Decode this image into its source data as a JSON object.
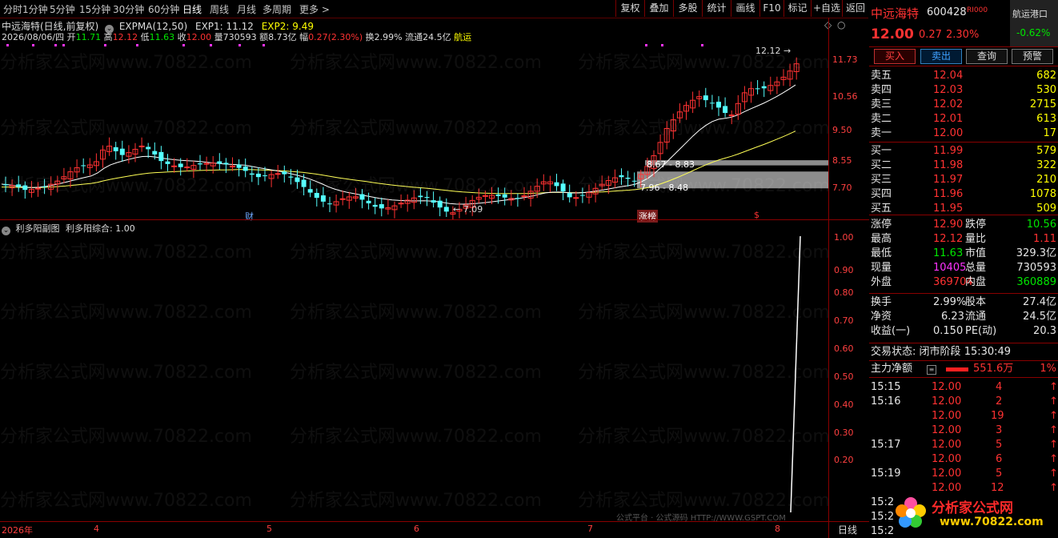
{
  "toolbar": {
    "periods": [
      "分时",
      "1分钟",
      "5分钟",
      "15分钟",
      "30分钟",
      "60分钟",
      "日线",
      "周线",
      "月线",
      "多周期",
      "更多 >"
    ],
    "active_period": "日线",
    "buttons": [
      "复权",
      "叠加",
      "多股",
      "统计",
      "画线",
      "F10",
      "标记",
      "+自选",
      "返回"
    ]
  },
  "info": {
    "stock_name": "中远海特(日线,前复权)",
    "indicator": "EXPMA(12,50)",
    "exp1": "EXP1: 11.12",
    "exp2": "EXP2: 9.49",
    "date": "2026/08/06/四",
    "open_label": "开",
    "open": "11.71",
    "high_label": "高",
    "high": "12.12",
    "low_label": "低",
    "low": "11.63",
    "close_label": "收",
    "close": "12.00",
    "vol_label": "量",
    "vol": "730593",
    "amount": "额8.73亿",
    "change_label": "幅",
    "change": "0.27(2.30%)",
    "turnover": "换2.99%",
    "float": "流通24.5亿",
    "sector": "航运"
  },
  "price_axis": [
    "11.73",
    "10.56",
    "9.50",
    "8.55",
    "7.70"
  ],
  "annotations": {
    "high_mark": "12.12",
    "low_mark": "7.09",
    "box1": "8.67 - 8.83",
    "box2": "7.96 - 8.48",
    "tag_cai": "财",
    "tag_zt": "涨榜",
    "tag_s": "$"
  },
  "sub": {
    "title": "利多阳副图",
    "value": "利多阳综合: 1.00",
    "axis": [
      "1.00",
      "0.90",
      "0.80",
      "0.70",
      "0.60",
      "0.50",
      "0.40",
      "0.30",
      "0.20"
    ]
  },
  "xaxis": [
    "2026年",
    "4",
    "5",
    "6",
    "7",
    "8"
  ],
  "xaxis_mode": "日线",
  "watermark_text": "分析家公式网www.70822.com",
  "bottom_source": "公式平台 · 公式源码 HTTP://WWW.GSPT.COM",
  "logo": {
    "line1": "分析家公式网",
    "line2": "www.70822.com"
  },
  "panel": {
    "name": "中远海特",
    "code": "600428",
    "flag": "R",
    "sector": "航运港口",
    "sector_change": "-0.62%",
    "price": "12.00",
    "change": "0.27",
    "pct": "2.30%",
    "btn_buy": "买入",
    "btn_sell": "卖出",
    "btn_query": "查询",
    "btn_alert": "预警",
    "asks": [
      {
        "label": "卖五",
        "price": "12.04",
        "vol": "682"
      },
      {
        "label": "卖四",
        "price": "12.03",
        "vol": "530"
      },
      {
        "label": "卖三",
        "price": "12.02",
        "vol": "2715"
      },
      {
        "label": "卖二",
        "price": "12.01",
        "vol": "613"
      },
      {
        "label": "卖一",
        "price": "12.00",
        "vol": "17"
      }
    ],
    "bids": [
      {
        "label": "买一",
        "price": "11.99",
        "vol": "579"
      },
      {
        "label": "买二",
        "price": "11.98",
        "vol": "322"
      },
      {
        "label": "买三",
        "price": "11.97",
        "vol": "210"
      },
      {
        "label": "买四",
        "price": "11.96",
        "vol": "1078"
      },
      {
        "label": "买五",
        "price": "11.95",
        "vol": "509"
      }
    ],
    "stats": [
      {
        "l1": "涨停",
        "v1": "12.90",
        "l2": "跌停",
        "v2": "10.56"
      },
      {
        "l1": "最高",
        "v1": "12.12",
        "l2": "量比",
        "v2": "1.11"
      },
      {
        "l1": "最低",
        "v1": "11.63",
        "l2": "市值",
        "v2": "329.3亿"
      },
      {
        "l1": "现量",
        "v1": "10405",
        "l2": "总量",
        "v2": "730593"
      },
      {
        "l1": "外盘",
        "v1": "369704",
        "l2": "内盘",
        "v2": "360889"
      }
    ],
    "stats2": [
      {
        "l1": "换手",
        "v1": "2.99%",
        "l2": "股本",
        "v2": "27.4亿"
      },
      {
        "l1": "净资",
        "v1": "6.23",
        "l2": "流通",
        "v2": "24.5亿"
      },
      {
        "l1": "收益(一)",
        "v1": "0.150",
        "l2": "PE(动)",
        "v2": "20.3"
      }
    ],
    "trade_status_label": "交易状态:",
    "trade_status": "闭市阶段",
    "trade_time": "15:30:49",
    "main_net_label": "主力净额",
    "main_net": "551.6万",
    "main_net_pct": "1%",
    "ticks": [
      {
        "t": "15:15",
        "p": "12.00",
        "v": "4"
      },
      {
        "t": "15:16",
        "p": "12.00",
        "v": "2"
      },
      {
        "t": "",
        "p": "12.00",
        "v": "19"
      },
      {
        "t": "",
        "p": "12.00",
        "v": "3"
      },
      {
        "t": "15:17",
        "p": "12.00",
        "v": "5"
      },
      {
        "t": "",
        "p": "12.00",
        "v": "6"
      },
      {
        "t": "15:19",
        "p": "12.00",
        "v": "5"
      },
      {
        "t": "",
        "p": "12.00",
        "v": "12"
      },
      {
        "t": "15:2",
        "p": "",
        "v": ""
      },
      {
        "t": "15:2",
        "p": "",
        "v": ""
      },
      {
        "t": "15:2",
        "p": "",
        "v": ""
      }
    ]
  }
}
